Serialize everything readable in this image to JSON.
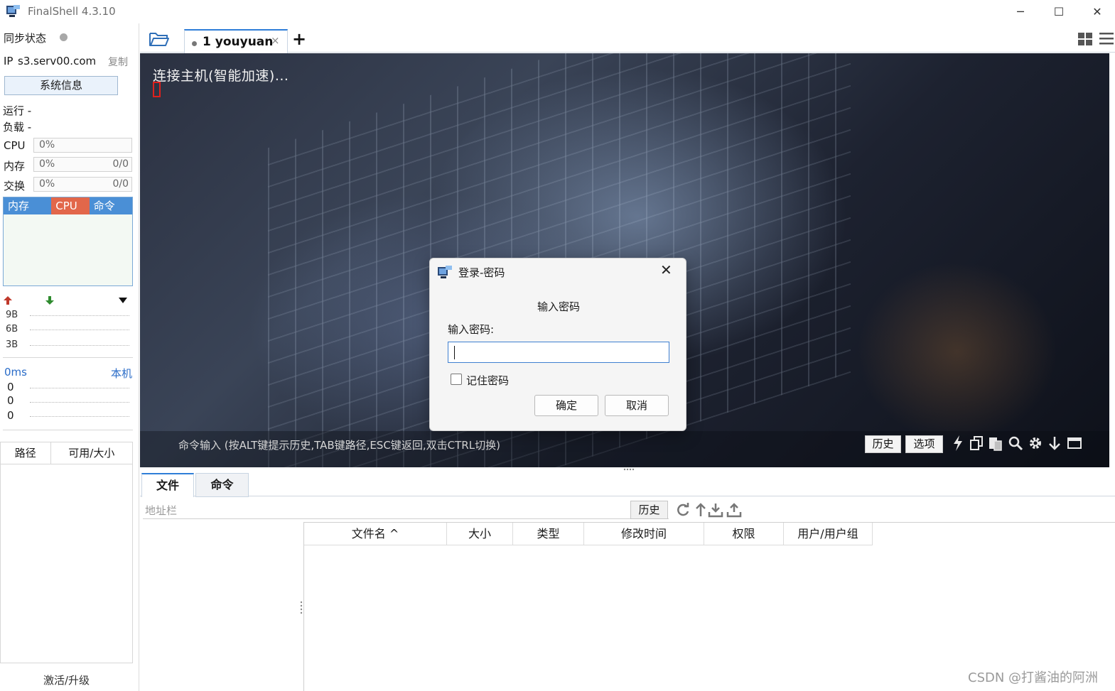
{
  "window": {
    "title": "FinalShell 4.3.10",
    "controls": {
      "minimize": "─",
      "maximize": "☐",
      "close": "✕"
    }
  },
  "sidebar": {
    "sync_label": "同步状态",
    "ip_label": "IP",
    "ip_value": "s3.serv00.com",
    "copy_label": "复制",
    "sysinfo_button": "系统信息",
    "run_label": "运行 -",
    "load_label": "负载 -",
    "meters": [
      {
        "label": "CPU",
        "percent": "0%",
        "count": ""
      },
      {
        "label": "内存",
        "percent": "0%",
        "count": "0/0"
      },
      {
        "label": "交换",
        "percent": "0%",
        "count": "0/0"
      }
    ],
    "proc_tabs": [
      {
        "label": "内存",
        "color": "#4a8fd6"
      },
      {
        "label": "CPU",
        "color": "#e2674a"
      },
      {
        "label": "命令",
        "color": "#4a8fd6"
      }
    ],
    "net_scale": [
      "9B",
      "6B",
      "3B"
    ],
    "ping_ms": "0ms",
    "ping_host": "本机",
    "ping_values": [
      "0",
      "0",
      "0"
    ],
    "disk_columns": [
      "路径",
      "可用/大小"
    ],
    "activate_label": "激活/升级"
  },
  "session": {
    "tab_label": "1 youyuan",
    "tab_close": "×",
    "add_tab": "+"
  },
  "terminal": {
    "output_line": "连接主机(智能加速)...",
    "cmd_hint": "命令输入 (按ALT键提示历史,TAB键路径,ESC键返回,双击CTRL切换)",
    "history_button": "历史",
    "options_button": "选项"
  },
  "file_panel": {
    "tabs": [
      "文件",
      "命令"
    ],
    "address_placeholder": "地址栏",
    "history_button": "历史",
    "columns": [
      "文件名 ^",
      "大小",
      "类型",
      "修改时间",
      "权限",
      "用户/用户组"
    ]
  },
  "dialog": {
    "title": "登录-密码",
    "close": "✕",
    "heading": "输入密码",
    "field_label": "输入密码:",
    "password_value": "",
    "remember_label": "记住密码",
    "remember_checked": false,
    "ok_button": "确定",
    "cancel_button": "取消"
  },
  "watermark": "CSDN @打酱油的阿洲",
  "colors": {
    "accent": "#2f7ed8",
    "cursor_red": "#e0201c",
    "upload_red": "#c0392b",
    "download_green": "#2e8b2e"
  }
}
